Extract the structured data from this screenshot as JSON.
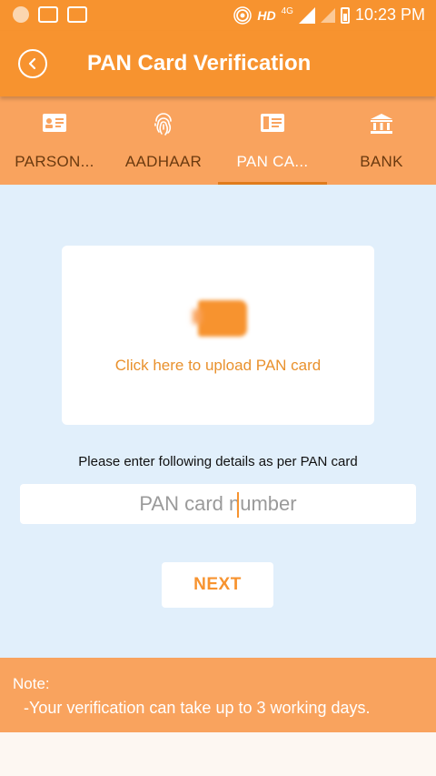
{
  "status_bar": {
    "network": "HD",
    "network_type": "4G",
    "time": "10:23 PM"
  },
  "app_bar": {
    "title": "PAN Card Verification",
    "back_icon": "back-arrow-circle-icon"
  },
  "tabs": [
    {
      "label": "PARSON...",
      "icon": "id-card-icon",
      "active": false
    },
    {
      "label": "AADHAAR",
      "icon": "fingerprint-icon",
      "active": false
    },
    {
      "label": "PAN CA...",
      "icon": "card-icon",
      "active": true
    },
    {
      "label": "BANK",
      "icon": "bank-icon",
      "active": false
    }
  ],
  "upload": {
    "label": "Click here to upload PAN card"
  },
  "form": {
    "instruction": "Please enter following details as per PAN card",
    "pan_placeholder": "PAN card number",
    "pan_value": ""
  },
  "next_button": {
    "label": "NEXT"
  },
  "note": {
    "title": "Note:",
    "text": "-Your verification can take up to 3 working days."
  },
  "colors": {
    "primary": "#f7932f",
    "tab_bg": "#f9a35e",
    "content_bg": "#e1effb",
    "upload_text": "#e9912d"
  }
}
